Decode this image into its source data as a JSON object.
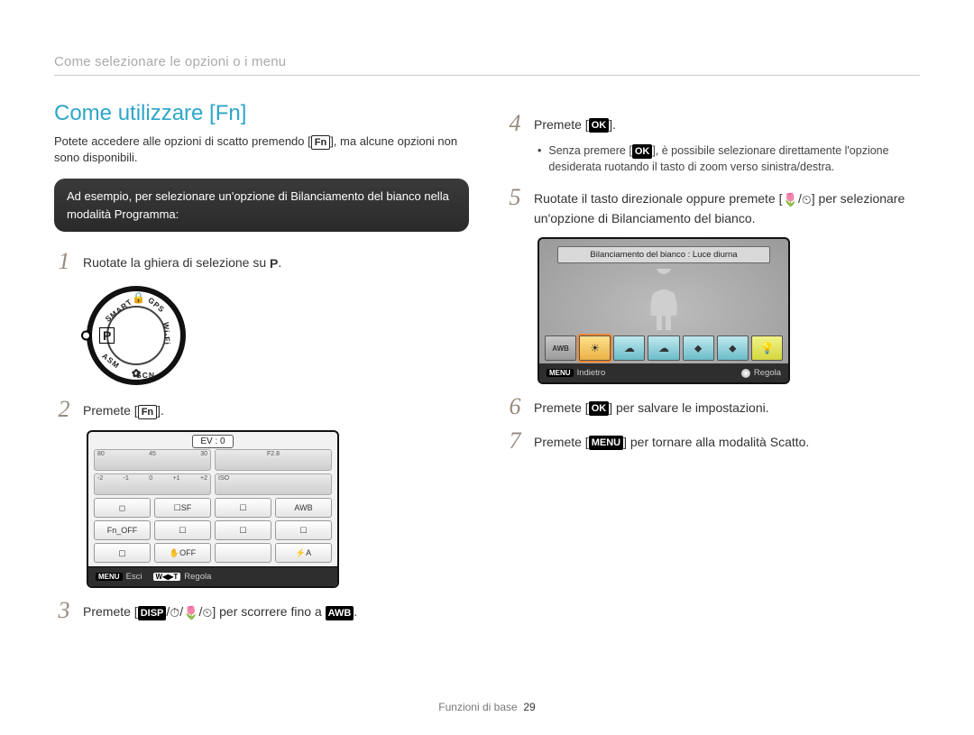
{
  "header": "Come selezionare le opzioni o i menu",
  "title": "Come utilizzare [Fn]",
  "intro_a": "Potete accedere alle opzioni di scatto premendo [",
  "intro_b": "], ma alcune opzioni non sono disponibili.",
  "icon_fn": "Fn",
  "example": "Ad esempio, per selezionare un'opzione di Bilanciamento del bianco nella modalità Programma:",
  "steps": {
    "s1": {
      "num": "1",
      "text_a": "Ruotate la ghiera di selezione su ",
      "text_b": ".",
      "icon": "P"
    },
    "s2": {
      "num": "2",
      "text_a": "Premete [",
      "text_b": "].",
      "icon": "Fn"
    },
    "s3": {
      "num": "3",
      "text_a": "Premete [",
      "text_mid": "] per scorrere fino a ",
      "text_b": ".",
      "icons": [
        "DISP",
        "/",
        "⏱",
        "/",
        "🌷",
        "/",
        "⏲"
      ],
      "awb": "AWB"
    },
    "s4": {
      "num": "4",
      "text_a": "Premete [",
      "text_b": "].",
      "icon": "OK"
    },
    "s4_bullet_a": "Senza premere [",
    "s4_bullet_b": "], è possibile selezionare direttamente l'opzione desiderata ruotando il tasto di zoom verso sinistra/destra.",
    "s5": {
      "num": "5",
      "text_a": "Ruotate il tasto direzionale oppure premete [",
      "text_b": "] per selezionare un'opzione di Bilanciamento del bianco.",
      "icons": [
        "🌷",
        "/",
        "⏲"
      ]
    },
    "s6": {
      "num": "6",
      "text_a": "Premete [",
      "text_b": "] per salvare le impostazioni.",
      "icon": "OK"
    },
    "s7": {
      "num": "7",
      "text_a": "Premete [",
      "text_b": "] per tornare alla modalità Scatto.",
      "icon": "MENU"
    }
  },
  "mode_dial": {
    "p": "P",
    "smart": "SMART",
    "gps": "GPS",
    "wifi": "Wi-Fi",
    "scn": "SCN",
    "asm": "ASM"
  },
  "screen1": {
    "ev": "EV : 0",
    "slider_left_ticks": [
      "80",
      "45",
      "30"
    ],
    "slider_right_1": "F2.8",
    "slider_right_ticks": [
      "-2",
      "-1",
      "0",
      "+1",
      "+2"
    ],
    "slider_right_iso": "ISO",
    "row1": [
      "◻",
      "☐SF",
      "☐",
      "AWB"
    ],
    "row2": [
      "Fn_OFF",
      "☐",
      "☐",
      "☐"
    ],
    "row3": [
      "▢",
      "✋OFF",
      "",
      "⚡A"
    ],
    "bar_menu_tag": "MENU",
    "bar_left": "Esci",
    "bar_wt_tag": "W◀▶T",
    "bar_right": "Regola"
  },
  "wb_screen": {
    "title": "Bilanciamento del bianco : Luce diurna",
    "options": [
      "AWB",
      "☀",
      "☁",
      "☁",
      "⬥",
      "⬥",
      "💡"
    ],
    "bar_menu_tag": "MENU",
    "bar_left": "Indietro",
    "bar_right": "Regola"
  },
  "footer_label": "Funzioni di base",
  "footer_page": "29"
}
